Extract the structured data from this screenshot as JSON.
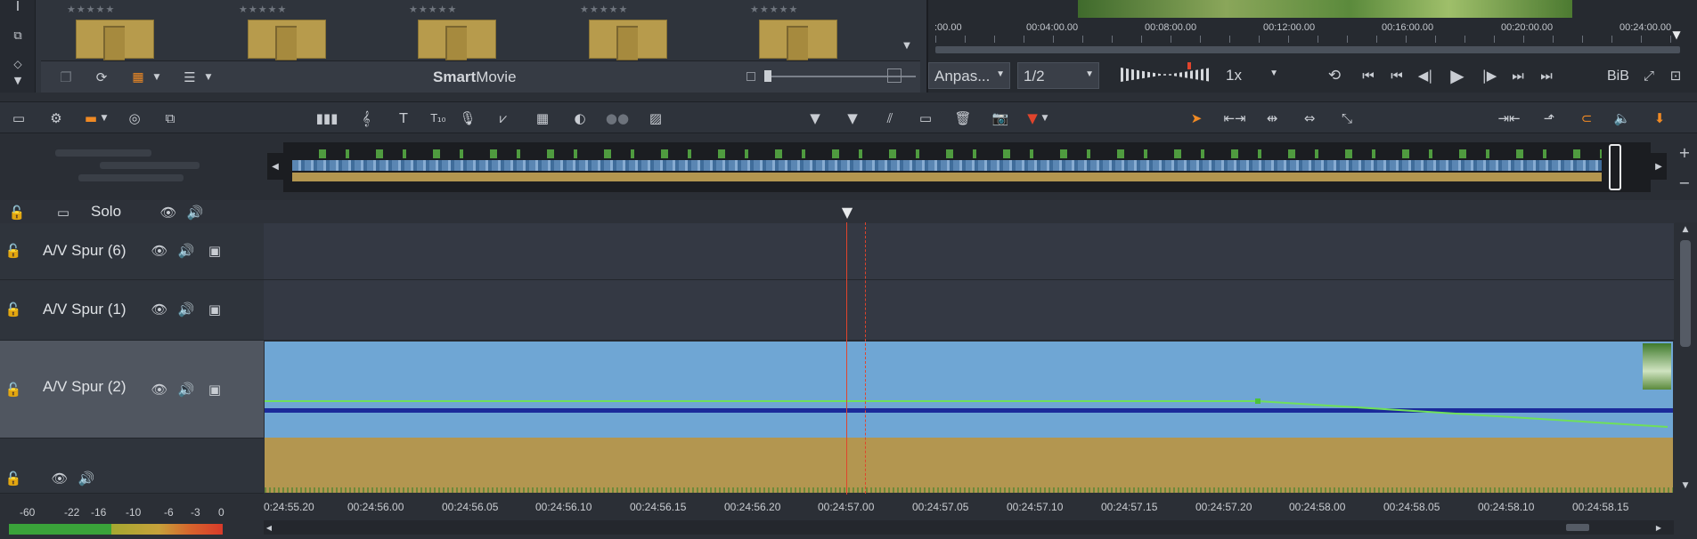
{
  "library": {
    "title_plain": "Movie",
    "title_bold": "Smart",
    "stars": "★★★★★"
  },
  "preview": {
    "timecodes": [
      ":00.00",
      "00:04:00.00",
      "00:08:00.00",
      "00:12:00.00",
      "00:16:00.00",
      "00:20:00.00",
      "00:24:00.00"
    ],
    "fit_dropdown": "Anpas...",
    "quality_dropdown": "1/2",
    "speed_dropdown": "1x",
    "pip_label": "BiB"
  },
  "tracks": {
    "solo_label": "Solo",
    "track_labels": [
      "A/V Spur (6)",
      "A/V Spur (1)",
      "A/V Spur (2)"
    ]
  },
  "ruler": {
    "ticks": [
      "0:24:55.20",
      "00:24:56.00",
      "00:24:56.05",
      "00:24:56.10",
      "00:24:56.15",
      "00:24:56.20",
      "00:24:57.00",
      "00:24:57.05",
      "00:24:57.10",
      "00:24:57.15",
      "00:24:57.20",
      "00:24:58.00",
      "00:24:58.05",
      "00:24:58.10",
      "00:24:58.15"
    ]
  },
  "meter": {
    "labels": [
      "-60",
      "-22",
      "-16",
      "-10",
      "-6",
      "-3",
      "0"
    ]
  },
  "colors": {
    "video_clip": "#6fa6d4",
    "audio_clip": "#b39650",
    "playhead": "#e0442c",
    "volume_line": "#6fe05a",
    "accent": "#f08a24"
  }
}
